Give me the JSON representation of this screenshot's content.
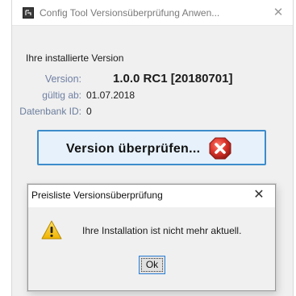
{
  "window": {
    "title": "Config Tool Versionsüberprüfung Anwen...",
    "close_symbol": "✕",
    "app_icon": "app-logo-icon"
  },
  "main": {
    "heading": "Ihre installierte Version",
    "fields": {
      "version_label": "Version:",
      "version_value": "1.0.0 RC1 [20180701]",
      "valid_label": "gültig ab:",
      "valid_value": "01.07.2018",
      "db_label": "Datenbank ID:",
      "db_value": "0"
    },
    "check_button": {
      "label": "Version überprüfen...",
      "icon": "error-x-icon"
    }
  },
  "dialog": {
    "title": "Preisliste Versionsüberprüfung",
    "close_symbol": "✕",
    "icon": "warning-icon",
    "message": "Ihre Installation ist nicht mehr aktuell.",
    "ok_label": "Ok"
  },
  "colors": {
    "button_border": "#3d8ccb",
    "button_bg": "#e6f1fb",
    "error_red": "#d9322a",
    "warning_yellow": "#f7c600",
    "label_blue_gray": "#6f7fa3"
  }
}
